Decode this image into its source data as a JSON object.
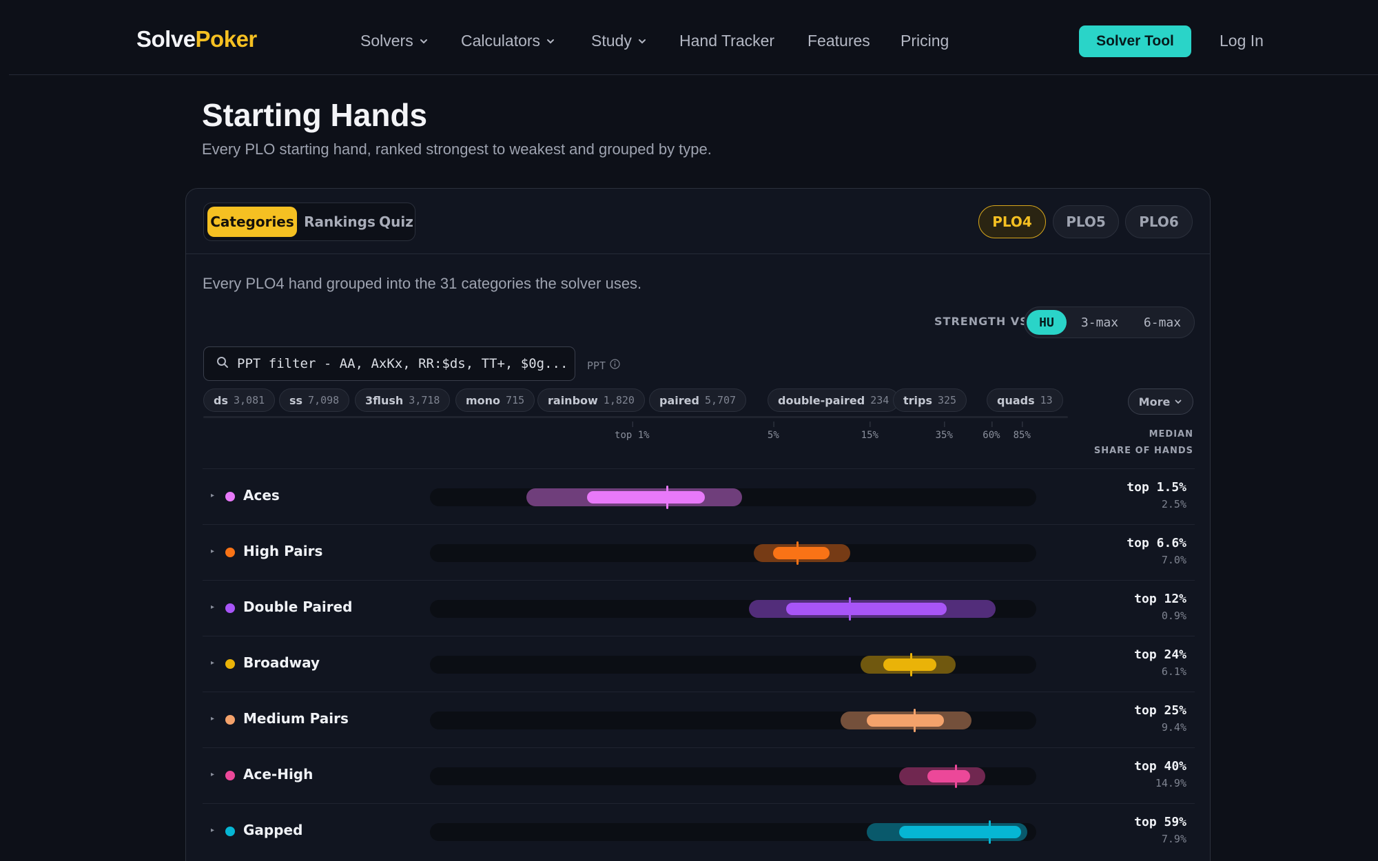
{
  "header": {
    "logo_part1": "Solve",
    "logo_part2": "Poker",
    "nav": [
      {
        "label": "Solvers",
        "dropdown": true
      },
      {
        "label": "Calculators",
        "dropdown": true
      },
      {
        "label": "Study",
        "dropdown": true
      },
      {
        "label": "Hand Tracker",
        "dropdown": false
      },
      {
        "label": "Features",
        "dropdown": false
      },
      {
        "label": "Pricing",
        "dropdown": false
      }
    ],
    "cta_label": "Solver Tool",
    "login_label": "Log In"
  },
  "page": {
    "title": "Starting Hands",
    "subtitle": "Every PLO starting hand, ranked strongest to weakest and grouped by type."
  },
  "tabs": [
    {
      "label": "Categories",
      "active": true
    },
    {
      "label": "Rankings",
      "active": false
    },
    {
      "label": "Quiz",
      "active": false
    }
  ],
  "variants": [
    {
      "label": "PLO4",
      "active": true
    },
    {
      "label": "PLO5",
      "active": false
    },
    {
      "label": "PLO6",
      "active": false
    }
  ],
  "description": "Every PLO4 hand grouped into the 31 categories the solver uses.",
  "strength": {
    "label": "STRENGTH VS",
    "options": [
      {
        "label": "HU",
        "active": true
      },
      {
        "label": "3-max",
        "active": false
      },
      {
        "label": "6-max",
        "active": false
      }
    ]
  },
  "search": {
    "placeholder": "PPT filter - AA, AxKx, RR:$ds, TT+, $0g...",
    "value": ""
  },
  "ppt_label": "PPT",
  "chips": [
    {
      "label": "ds",
      "count": "3,081"
    },
    {
      "label": "ss",
      "count": "7,098"
    },
    {
      "label": "3flush",
      "count": "3,718"
    },
    {
      "label": "mono",
      "count": "715"
    },
    {
      "label": "rainbow",
      "count": "1,820"
    },
    {
      "label": "paired",
      "count": "5,707"
    },
    {
      "label": "double-paired",
      "count": "234"
    },
    {
      "label": "trips",
      "count": "325"
    },
    {
      "label": "quads",
      "count": "13"
    }
  ],
  "more_label": "More",
  "axis_ticks": [
    "top 1%",
    "5%",
    "15%",
    "35%",
    "60%",
    "85%"
  ],
  "columns": {
    "median": "MEDIAN",
    "share": "SHARE OF HANDS"
  },
  "categories": [
    {
      "name": "Aces",
      "color": "#e879f9",
      "median": "top 1.5%",
      "share": "2.5%",
      "outer": [
        0.3,
        3.5
      ],
      "inner": [
        0.6,
        2.3
      ],
      "median_pct": 1.5
    },
    {
      "name": "High Pairs",
      "color": "#f97316",
      "median": "top 6.6%",
      "share": "7.0%",
      "outer": [
        4.0,
        12.0
      ],
      "inner": [
        5.0,
        9.5
      ],
      "median_pct": 6.6
    },
    {
      "name": "Double Paired",
      "color": "#a855f7",
      "median": "top 12%",
      "share": "0.9%",
      "outer": [
        3.8,
        63.0
      ],
      "inner": [
        5.8,
        36.0
      ],
      "median_pct": 12.0
    },
    {
      "name": "Broadway",
      "color": "#eab308",
      "median": "top 24%",
      "share": "6.1%",
      "outer": [
        13.5,
        40.0
      ],
      "inner": [
        17.5,
        32.0
      ],
      "median_pct": 24.0
    },
    {
      "name": "Medium Pairs",
      "color": "#f4a26b",
      "median": "top 25%",
      "share": "9.4%",
      "outer": [
        10.8,
        48.0
      ],
      "inner": [
        14.5,
        35.0
      ],
      "median_pct": 25.0
    },
    {
      "name": "Ace-High",
      "color": "#ec4899",
      "median": "top 40%",
      "share": "14.9%",
      "outer": [
        21.0,
        56.0
      ],
      "inner": [
        29.0,
        47.0
      ],
      "median_pct": 40.0
    },
    {
      "name": "Gapped",
      "color": "#06b6d4",
      "median": "top 59%",
      "share": "7.9%",
      "outer": [
        14.5,
        90.0
      ],
      "inner": [
        21.0,
        84.0
      ],
      "median_pct": 59.0
    }
  ]
}
